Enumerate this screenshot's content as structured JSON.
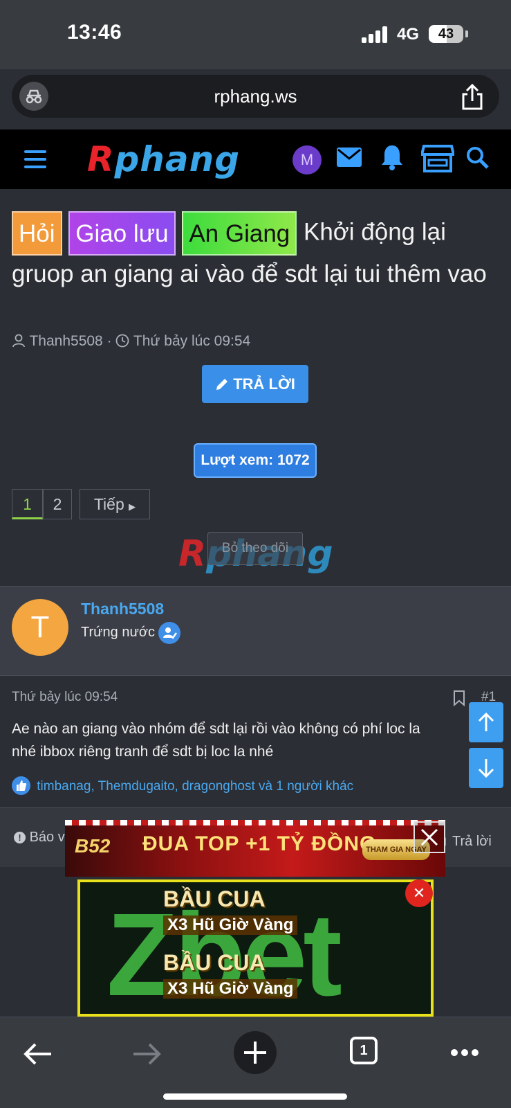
{
  "status_bar": {
    "time": "13:46",
    "network": "4G",
    "battery": "43"
  },
  "browser": {
    "url": "rphang.ws"
  },
  "site": {
    "logo": "Rphang",
    "avatar_letter": "M",
    "accent": "#3aa0ff"
  },
  "thread": {
    "tags": [
      "Hỏi",
      "Giao lưu",
      "An Giang"
    ],
    "title": "Khởi động lại gruop an giang ai vào để sdt lại tui thêm vao",
    "author": "Thanh5508",
    "separator": "·",
    "time": "Thứ bảy lúc 09:54",
    "reply_button": "TRẢ LỜI",
    "views": "Lượt xem: 1072",
    "pages": [
      "1",
      "2"
    ],
    "next_label": "Tiếp",
    "unfollow_label": "Bỏ theo dõi"
  },
  "post": {
    "user": {
      "initial": "T",
      "name": "Thanh5508",
      "title": "Trứng nước"
    },
    "date": "Thứ bảy lúc 09:54",
    "number": "#1",
    "body_line1": "Ae nào an giang vào nhóm để sdt lại rồi vào không có phí loc la",
    "body_line2": "nhé ibbox riêng tranh để sdt bị loc la nhé",
    "reactions": "timbanag, Themdugaito, dragonghost và 1 người khác",
    "report_label": "Báo vi",
    "reply_label": "Trả lời"
  },
  "ads": {
    "top": {
      "brand": "B52",
      "headline": "ĐUA TOP +1 TỶ ĐỒNG",
      "cta": "THAM GIA NGAY"
    },
    "main": {
      "brand": "Zbet",
      "line1": "BẦU CUA",
      "line2": "X3 Hũ Giờ Vàng"
    }
  },
  "toolbar": {
    "tab_count": "1"
  }
}
